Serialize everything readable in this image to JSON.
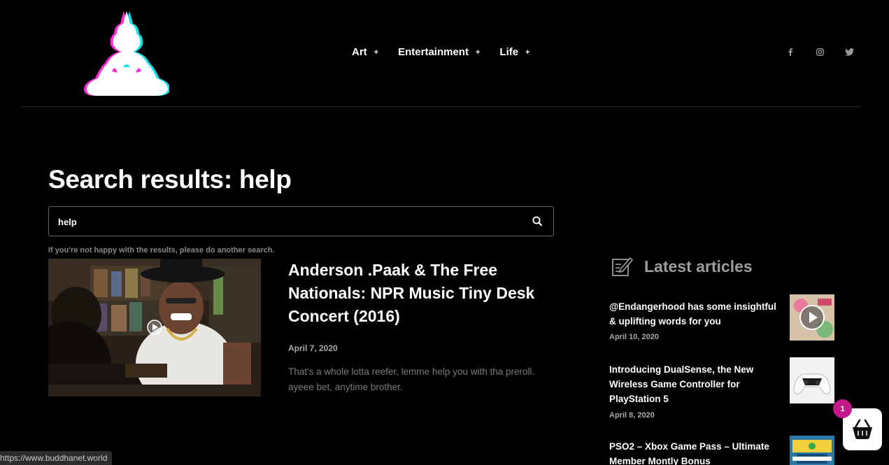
{
  "header": {
    "nav": [
      {
        "label": "Art",
        "icon": "+"
      },
      {
        "label": "Entertainment",
        "icon": "+"
      },
      {
        "label": "Life",
        "icon": "+"
      }
    ],
    "socials": [
      {
        "icon": "facebook-icon",
        "glyph": "f"
      },
      {
        "icon": "instagram-icon",
        "glyph": "◎"
      },
      {
        "icon": "twitter-icon",
        "glyph": "🐦"
      }
    ]
  },
  "main": {
    "title": "Search results: help",
    "search": {
      "value": "help",
      "placeholder": ""
    },
    "hint": "If you're not happy with the results, please do another search.",
    "result": {
      "title": "Anderson .Paak & The Free Nationals: NPR Music Tiny Desk Concert (2016)",
      "date": "April 7, 2020",
      "excerpt": "That's a whole lotta reefer, lemme help you with tha preroll. ayeee bet, anytime brother."
    }
  },
  "sidebar": {
    "heading": "Latest articles",
    "articles": [
      {
        "title": "@Endangerhood has some insightful & uplifting words for you",
        "date": "April 10, 2020"
      },
      {
        "title": "Introducing DualSense, the New Wireless Game Controller for PlayStation 5",
        "date": "April 8, 2020"
      },
      {
        "title": "PSO2 – Xbox Game Pass – Ultimate Member Montly Bonus",
        "date": ""
      }
    ]
  },
  "cart": {
    "count": "1"
  },
  "status_bar": {
    "url": "https://www.buddhanet.world"
  },
  "colors": {
    "accent": "#c2188a",
    "background": "#000000"
  }
}
